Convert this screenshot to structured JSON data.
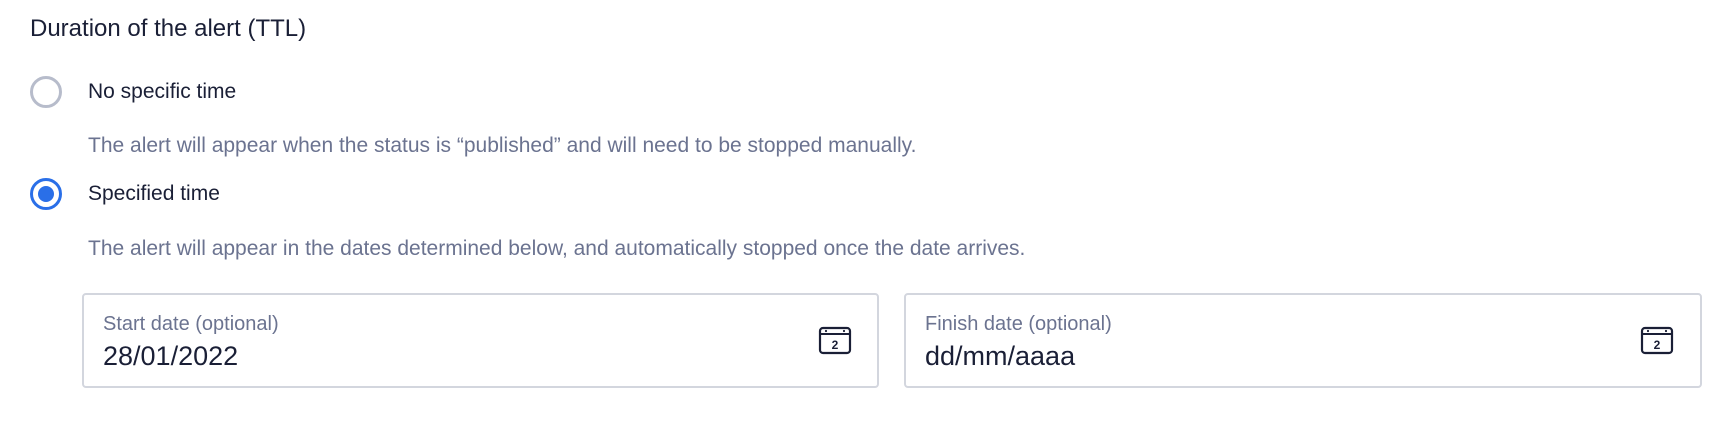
{
  "section": {
    "title": "Duration of the alert (TTL)"
  },
  "options": [
    {
      "label": "No specific time",
      "checked": false,
      "helper": "The alert will appear when the status is “published” and will need to be stopped manually."
    },
    {
      "label": "Specified time",
      "checked": true,
      "helper": "The alert will appear in the dates determined below, and automatically stopped once the date arrives."
    }
  ],
  "start_date": {
    "label": "Start date (optional)",
    "value": "28/01/2022",
    "icon": "calendar-icon",
    "icon_text": "2"
  },
  "finish_date": {
    "label": "Finish date (optional)",
    "value": "dd/mm/aaaa",
    "icon": "calendar-icon",
    "icon_text": "2"
  },
  "colors": {
    "accent": "#2a6fe8",
    "text": "#1a1f36",
    "muted": "#6b7390",
    "border": "#d3d6de"
  }
}
